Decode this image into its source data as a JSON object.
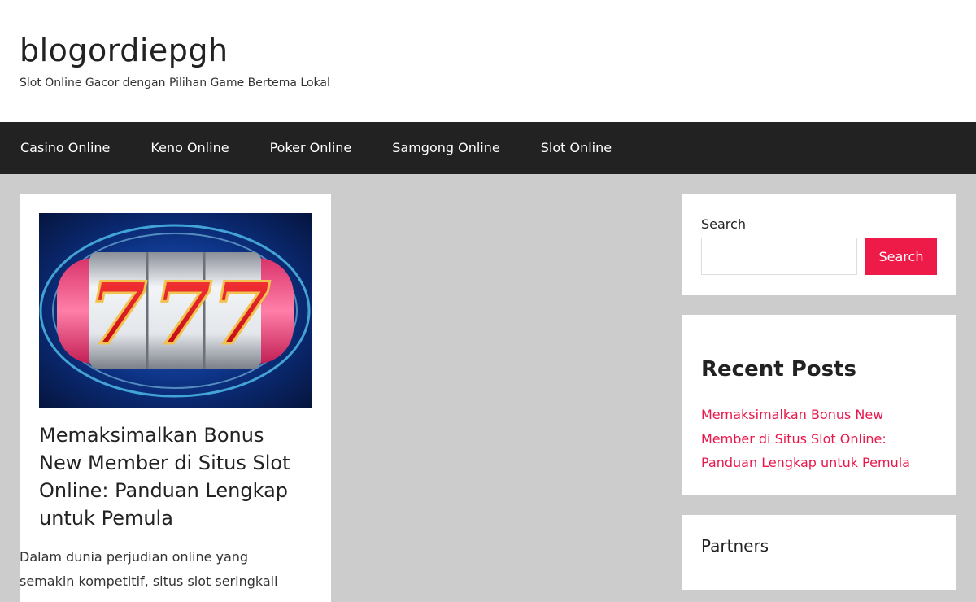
{
  "header": {
    "site_title": "blogordiepgh",
    "site_description": "Slot Online Gacor dengan Pilihan Game Bertema Lokal"
  },
  "nav": {
    "items": [
      {
        "label": "Casino Online"
      },
      {
        "label": "Keno Online"
      },
      {
        "label": "Poker Online"
      },
      {
        "label": "Samgong Online"
      },
      {
        "label": "Slot Online"
      }
    ]
  },
  "post": {
    "title": "Memaksimalkan Bonus New Member di Situs Slot Online: Panduan Lengkap untuk Pemula",
    "excerpt": "Dalam dunia perjudian online yang semakin kompetitif, situs slot seringkali",
    "thumbnail_icon": "slot-777-image",
    "thumbnail_digits": "777"
  },
  "sidebar": {
    "search": {
      "label": "Search",
      "placeholder": "",
      "value": "",
      "button_label": "Search"
    },
    "recent_posts": {
      "title": "Recent Posts",
      "items": [
        {
          "label": "Memaksimalkan Bonus New Member di Situs Slot Online: Panduan Lengkap untuk Pemula"
        }
      ]
    },
    "partners": {
      "title": "Partners"
    }
  },
  "colors": {
    "accent": "#ee1a47",
    "nav_bg": "#222222",
    "page_bg": "#cccccc"
  }
}
